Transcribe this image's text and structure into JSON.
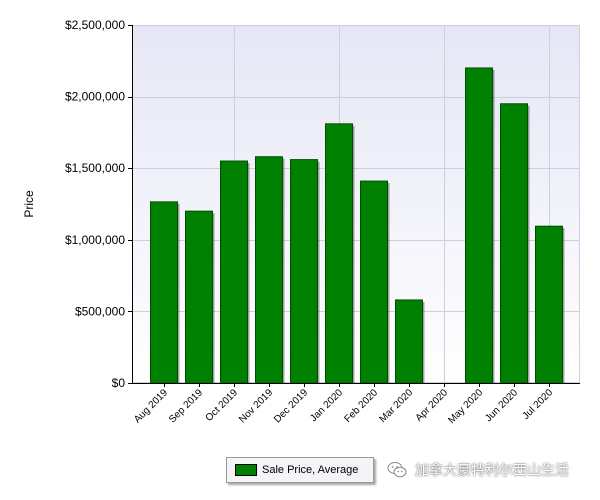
{
  "chart_data": {
    "type": "bar",
    "categories": [
      "Aug 2019",
      "Sep 2019",
      "Oct 2019",
      "Nov 2019",
      "Dec 2019",
      "Jan 2020",
      "Feb 2020",
      "Mar 2020",
      "Apr 2020",
      "May 2020",
      "Jun 2020",
      "Jul 2020"
    ],
    "series": [
      {
        "name": "Sale Price, Average",
        "values": [
          1265000,
          1200000,
          1550000,
          1580000,
          1560000,
          1810000,
          1410000,
          580000,
          null,
          2200000,
          1950000,
          1095000
        ]
      }
    ],
    "title": "",
    "xlabel": "",
    "ylabel": "Price",
    "ylim": [
      0,
      2500000
    ],
    "yticks": [
      0,
      500000,
      1000000,
      1500000,
      2000000,
      2500000
    ],
    "ytick_labels": [
      "$0",
      "$500,000",
      "$1,000,000",
      "$1,500,000",
      "$2,000,000",
      "$2,500,000"
    ],
    "grid": true,
    "legend_position": "bottom-center",
    "colors": {
      "bar": "#008000",
      "bar_edge": "#004d00",
      "plot_bg_top": "#e8e8f6",
      "plot_bg_bottom": "#ffffff",
      "grid": "#cfcfdc"
    }
  },
  "legend": {
    "label": "Sale Price, Average"
  },
  "watermark": {
    "text": "加拿大豪特利尔西山生活",
    "icon": "wechat-icon"
  }
}
